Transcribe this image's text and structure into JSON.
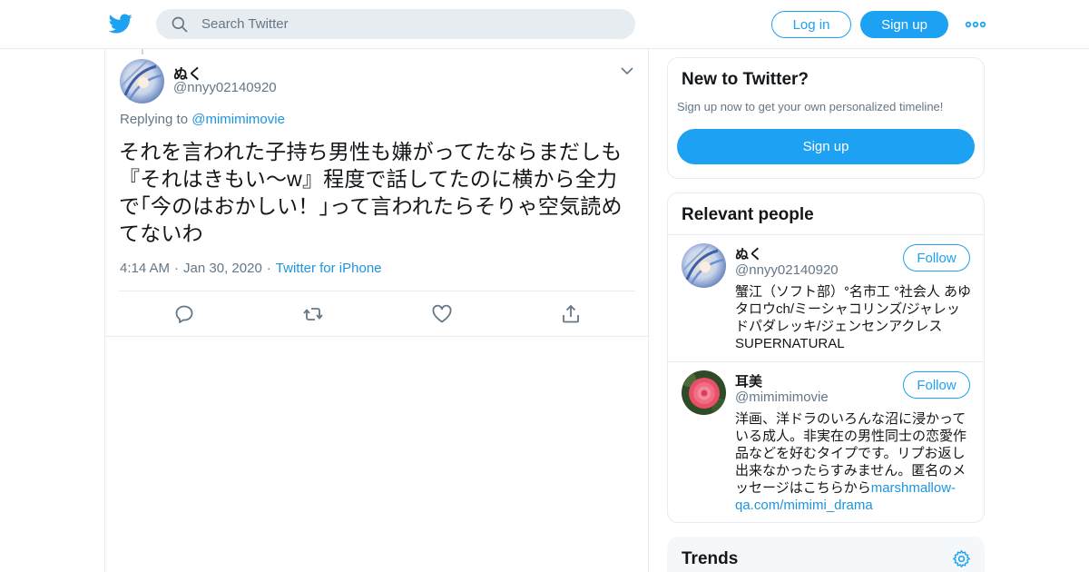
{
  "header": {
    "search_placeholder": "Search Twitter",
    "login_label": "Log in",
    "signup_label": "Sign up",
    "accent_color": "#1da1f2"
  },
  "tweet": {
    "name": "ぬく",
    "handle": "@nnyy02140920",
    "replying_prefix": "Replying to",
    "replying_to": "@mimimimovie",
    "text": "それを言われた子持ち男性も嫌がってたならまだしも『それはきもい〜w』程度で話してたのに横から全力で｢今のはおかしい！｣って言われたらそりゃ空気読めてないわ",
    "time": "4:14 AM",
    "date": "Jan 30, 2020",
    "source": "Twitter for iPhone",
    "actions": [
      "reply-icon",
      "retweet-icon",
      "like-icon",
      "share-icon"
    ]
  },
  "sidebar": {
    "new_to_twitter": {
      "title": "New to Twitter?",
      "subtitle": "Sign up now to get your own personalized timeline!",
      "button": "Sign up"
    },
    "relevant_people": {
      "title": "Relevant people",
      "people": [
        {
          "name": "ぬく",
          "handle": "@nnyy02140920",
          "bio": "蟹江（ソフト部）ᐤ名市工 ᐤ社会人 あゆタロウch/ミーシャコリンズ/ジャレッドパダレッキ/ジェンセンアクレス SUPERNATURAL",
          "follow": "Follow"
        },
        {
          "name": "耳美",
          "handle": "@mimimimovie",
          "bio": "洋画、洋ドラのいろんな沼に浸かっている成人。非実在の男性同士の恋愛作品などを好むタイプです。リプお返し出来なかったらすみません。匿名のメッセージはこちらから",
          "link": "marshmallow-qa.com/mimimi_drama",
          "follow": "Follow"
        }
      ]
    },
    "trends": {
      "title": "Trends"
    }
  }
}
